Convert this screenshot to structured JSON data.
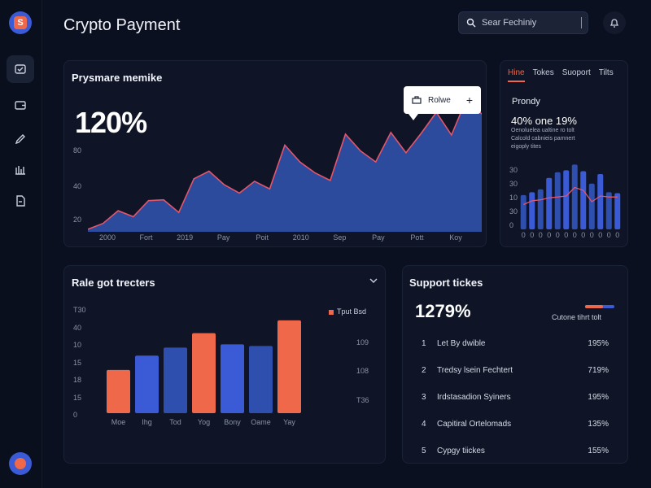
{
  "app": {
    "title": "Crypto Payment"
  },
  "header": {
    "search_value": "Sear Fechiniy",
    "icons": {
      "search": "search-icon",
      "bell": "bell-icon"
    }
  },
  "sidebar": {
    "items": [
      {
        "icon": "dashboard-icon",
        "active": true
      },
      {
        "icon": "wallet-icon",
        "active": false
      },
      {
        "icon": "pen-icon",
        "active": false
      },
      {
        "icon": "chart-icon",
        "active": false
      },
      {
        "icon": "document-icon",
        "active": false
      }
    ]
  },
  "colors": {
    "accent_blue": "#3b5bd6",
    "accent_orange": "#f0684a",
    "bg": "#0b1020",
    "card": "#0f1526"
  },
  "payment_card": {
    "title": "Prysmare memike",
    "big_value": "120%",
    "tooltip_label": "Rolwe",
    "chart_data": {
      "type": "area",
      "x_tick_labels": [
        "2000",
        "Fort",
        "2019",
        "Pay",
        "Poit",
        "2010",
        "Sep",
        "Pay",
        "Pott",
        "Koy"
      ],
      "y_tick_labels": [
        "80",
        "40",
        "20"
      ],
      "y_ticks": [
        80,
        40,
        20
      ],
      "ylim": [
        0,
        110
      ],
      "values": [
        3,
        10,
        25,
        18,
        37,
        38,
        23,
        63,
        72,
        56,
        46,
        60,
        51,
        103,
        83,
        70,
        61,
        116,
        96,
        83,
        118,
        94,
        117,
        142,
        115,
        158,
        140
      ]
    }
  },
  "right_card": {
    "tabs": [
      "Hine",
      "Tokes",
      "Suoport",
      "Tilts"
    ],
    "subtitle": "Prondy",
    "stat": "40% one 19%",
    "desc_lines": [
      "Oenoluelea ualtine ro tolt",
      "Calcold cabnieis pamnert",
      "eigoply tites"
    ],
    "chart_data": {
      "type": "bar",
      "y_tick_labels": [
        "30",
        "30",
        "10",
        "30",
        "0"
      ],
      "y_ticks": [
        30,
        30,
        10,
        30,
        0
      ],
      "ylim": [
        0,
        70
      ],
      "values": [
        36,
        39,
        42,
        54,
        60,
        62,
        68,
        61,
        48,
        58,
        39,
        38
      ],
      "line_values": [
        26,
        30,
        31,
        33,
        34,
        35,
        44,
        41,
        29,
        35,
        34,
        34
      ],
      "x_tick_labels": [
        "0",
        "0",
        "0",
        "0",
        "0",
        "0",
        "0",
        "0",
        "0",
        "0",
        "0",
        "0"
      ]
    }
  },
  "rate_card": {
    "title": "Rale got trecters",
    "legend": "Tput Bsd",
    "right_labels": [
      "109",
      "108",
      "T36"
    ],
    "chart_data": {
      "type": "bar",
      "categories": [
        "Moe",
        "Ihg",
        "Tod",
        "Yog",
        "Bony",
        "Oame",
        "Yay"
      ],
      "values": [
        27,
        36,
        41,
        50,
        43,
        42,
        58
      ],
      "colors": [
        "#f0684a",
        "#3b5bd6",
        "#2e4fae",
        "#f0684a",
        "#3b5bd6",
        "#2e4fae",
        "#f0684a"
      ],
      "y_tick_labels": [
        "T30",
        "40",
        "10",
        "15",
        "18",
        "15",
        "0"
      ],
      "ylim": [
        0,
        60
      ]
    }
  },
  "support_card": {
    "title": "Support tickes",
    "big_value": "1279%",
    "legend": "Cutone tihrt tolt",
    "progress": 0.6,
    "rows": [
      {
        "num": "1",
        "name": "Let By dwible",
        "pct": "195%"
      },
      {
        "num": "2",
        "name": "Tredsy lsein Fechtert",
        "pct": "719%"
      },
      {
        "num": "3",
        "name": "Irdstasadion Syiners",
        "pct": "195%"
      },
      {
        "num": "4",
        "name": "Capitiral Ortelomads",
        "pct": "135%"
      },
      {
        "num": "5",
        "name": "Cypgy tiickes",
        "pct": "155%"
      }
    ]
  }
}
